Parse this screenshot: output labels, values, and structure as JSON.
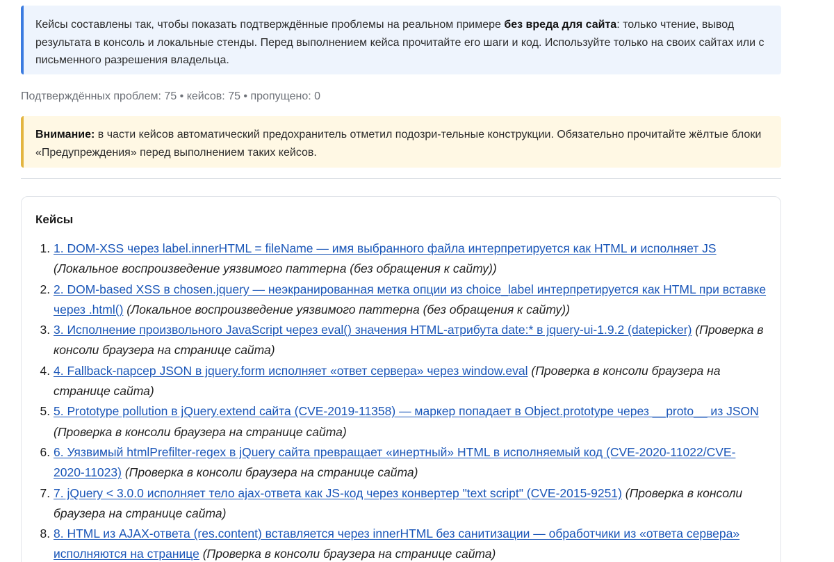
{
  "info": {
    "text_before": "Кейсы составлены так, чтобы показать подтверждённые проблемы на реальном примере ",
    "bold": "без вреда для сайта",
    "text_after": ": только чтение, вывод результата в консоль и локальные стенды. Перед выполнением кейса прочитайте его шаги и код. Используйте только на своих сайтах или с письменного разрешения владельца."
  },
  "stats": "Подтверждённых проблем: 75 • кейсов: 75 • пропущено: 0",
  "warning": {
    "bold": "Внимание:",
    "text": " в части кейсов автоматический предохранитель отметил подозри-тельные конструкции. Обязательно прочитайте жёлтые блоки «Предупреждения» перед выполнением таких кейсов."
  },
  "cases": {
    "title": "Кейсы",
    "items": [
      {
        "link": "1. DOM-XSS через label.innerHTML = fileName — имя выбранного файла интерпретируется как HTML и исполняет JS",
        "note": "(Локальное воспроизведение уязвимого паттерна (без обращения к сайту))"
      },
      {
        "link": "2. DOM-based XSS в chosen.jquery — неэкранированная метка опции из choice_label интерпретируется как HTML при вставке через .html()",
        "note": "(Локальное воспроизведение уязвимого паттерна (без обращения к сайту))"
      },
      {
        "link": "3. Исполнение произвольного JavaScript через eval() значения HTML-атрибута date:* в jquery-ui-1.9.2 (datepicker)",
        "note": "(Проверка в консоли браузера на странице сайта)"
      },
      {
        "link": "4. Fallback-парсер JSON в jquery.form исполняет «ответ сервера» через window.eval",
        "note": "(Проверка в консоли браузера на странице сайта)"
      },
      {
        "link": "5. Prototype pollution в jQuery.extend сайта (CVE-2019-11358) — маркер попадает в Object.prototype через __proto__ из JSON",
        "note": "(Проверка в консоли браузера на странице сайта)"
      },
      {
        "link": "6. Уязвимый htmlPrefilter-regex в jQuery сайта превращает «инертный» HTML в исполняемый код (CVE-2020-11022/CVE-2020-11023)",
        "note": "(Проверка в консоли браузера на странице сайта)"
      },
      {
        "link": "7. jQuery < 3.0.0 исполняет тело ajax-ответа как JS-код через конвертер \"text script\" (CVE-2015-9251)",
        "note": "(Проверка в консоли браузера на странице сайта)"
      },
      {
        "link": "8. HTML из AJAX-ответа (res.content) вставляется через innerHTML без санитизации — обработчики из «ответа сервера» исполняются на странице",
        "note": "(Проверка в консоли браузера на странице сайта)"
      }
    ]
  }
}
